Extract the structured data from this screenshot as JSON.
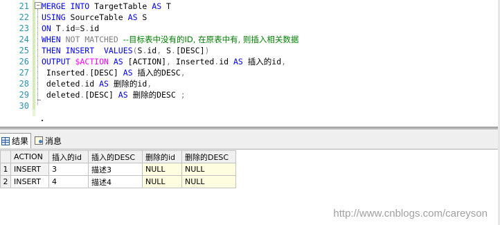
{
  "editor": {
    "line_numbers": [
      "21",
      "22",
      "23",
      "24",
      "25",
      "26",
      "27",
      "28",
      "29",
      "30"
    ],
    "fold_symbol": "−",
    "lines": [
      [
        {
          "t": "MERGE INTO ",
          "c": "kw"
        },
        {
          "t": "TargetTable ",
          "c": "plain"
        },
        {
          "t": "AS ",
          "c": "kw"
        },
        {
          "t": "T",
          "c": "plain"
        }
      ],
      [
        {
          "t": "USING ",
          "c": "kw"
        },
        {
          "t": "SourceTable ",
          "c": "plain"
        },
        {
          "t": "AS ",
          "c": "kw"
        },
        {
          "t": "S",
          "c": "plain"
        }
      ],
      [
        {
          "t": "ON ",
          "c": "kw"
        },
        {
          "t": "T",
          "c": "plain"
        },
        {
          "t": ".",
          "c": "gray"
        },
        {
          "t": "id",
          "c": "plain"
        },
        {
          "t": "=",
          "c": "gray"
        },
        {
          "t": "S",
          "c": "plain"
        },
        {
          "t": ".",
          "c": "gray"
        },
        {
          "t": "id",
          "c": "plain"
        }
      ],
      [
        {
          "t": "WHEN ",
          "c": "kw"
        },
        {
          "t": "NOT MATCHED ",
          "c": "gray"
        },
        {
          "t": "--目标表中没有的ID, 在原表中有, 则插入相关数据",
          "c": "cm"
        }
      ],
      [
        {
          "t": "THEN INSERT  VALUES",
          "c": "kw"
        },
        {
          "t": "(",
          "c": "gray"
        },
        {
          "t": "S",
          "c": "plain"
        },
        {
          "t": ".",
          "c": "gray"
        },
        {
          "t": "id",
          "c": "plain"
        },
        {
          "t": ", ",
          "c": "gray"
        },
        {
          "t": "S",
          "c": "plain"
        },
        {
          "t": ".",
          "c": "gray"
        },
        {
          "t": "[DESC]",
          "c": "plain"
        },
        {
          "t": ")",
          "c": "gray"
        }
      ],
      [
        {
          "t": "OUTPUT ",
          "c": "kw"
        },
        {
          "t": "$ACTION ",
          "c": "mg"
        },
        {
          "t": "AS ",
          "c": "kw"
        },
        {
          "t": "[ACTION]",
          "c": "plain"
        },
        {
          "t": ", ",
          "c": "gray"
        },
        {
          "t": "Inserted",
          "c": "plain"
        },
        {
          "t": ".",
          "c": "gray"
        },
        {
          "t": "id ",
          "c": "plain"
        },
        {
          "t": "AS ",
          "c": "kw"
        },
        {
          "t": "插入的",
          "c": "cn"
        },
        {
          "t": "id",
          "c": "plain"
        },
        {
          "t": ",",
          "c": "gray"
        }
      ],
      [
        {
          "t": " Inserted",
          "c": "plain"
        },
        {
          "t": ".",
          "c": "gray"
        },
        {
          "t": "[DESC] ",
          "c": "plain"
        },
        {
          "t": "AS ",
          "c": "kw"
        },
        {
          "t": "插入的",
          "c": "cn"
        },
        {
          "t": "DESC",
          "c": "plain"
        },
        {
          "t": ",",
          "c": "gray"
        }
      ],
      [
        {
          "t": " deleted",
          "c": "plain"
        },
        {
          "t": ".",
          "c": "gray"
        },
        {
          "t": "id ",
          "c": "plain"
        },
        {
          "t": "AS ",
          "c": "kw"
        },
        {
          "t": "删除的",
          "c": "cn"
        },
        {
          "t": "id",
          "c": "plain"
        },
        {
          "t": ",",
          "c": "gray"
        }
      ],
      [
        {
          "t": " deleted",
          "c": "plain"
        },
        {
          "t": ".",
          "c": "gray"
        },
        {
          "t": "[DESC] ",
          "c": "plain"
        },
        {
          "t": "AS ",
          "c": "kw"
        },
        {
          "t": "删除的",
          "c": "cn"
        },
        {
          "t": "DESC ",
          "c": "plain"
        },
        {
          "t": ";",
          "c": "gray"
        }
      ],
      []
    ]
  },
  "tabs": {
    "results_label": "结果",
    "messages_label": "消息"
  },
  "grid": {
    "columns": [
      "ACTION",
      "插入的id",
      "插入的DESC",
      "删除的id",
      "删除的DESC"
    ],
    "rows": [
      {
        "num": "1",
        "cells": [
          "INSERT",
          "3",
          "描述3",
          "NULL",
          "NULL"
        ]
      },
      {
        "num": "2",
        "cells": [
          "INSERT",
          "4",
          "描述4",
          "NULL",
          "NULL"
        ]
      }
    ]
  },
  "watermark": "http://www.cnblogs.com/careyson",
  "colors": {
    "keyword": "#0000ff",
    "comment": "#008000",
    "system_function": "#ff00ff",
    "operator": "#808080",
    "line_number": "#2b91af",
    "null_cell_bg": "#fffde0"
  }
}
